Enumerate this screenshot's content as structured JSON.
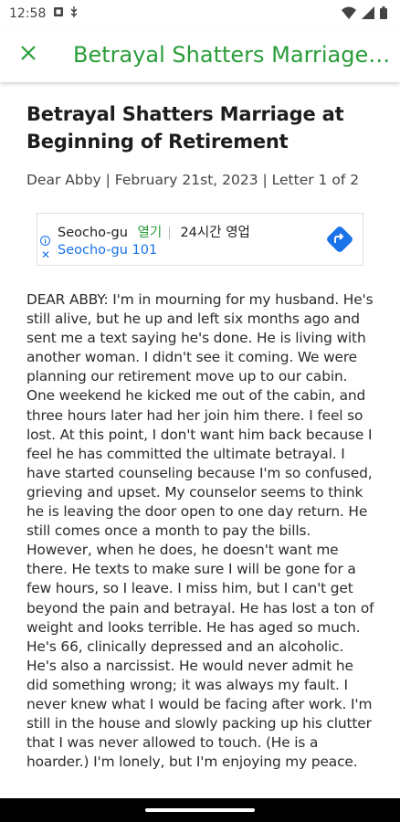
{
  "status_bar": {
    "time": "12:58"
  },
  "app_bar": {
    "title": "Betrayal Shatters Marriage…"
  },
  "article": {
    "headline": "Betrayal Shatters Marriage at Beginning of Retirement",
    "byline": "Dear Abby | February 21st, 2023 | Letter 1 of 2",
    "body": "DEAR ABBY: I'm in mourning for my husband. He's still alive, but he up and left six months ago and sent me a text saying he's done. He is living with another woman. I didn't see it coming. We were planning our retirement move up to our cabin. One weekend he kicked me out of the cabin, and three hours later had her join him there. I feel so lost. At this point, I don't want him back because I feel he has committed the ultimate betrayal. I have started counseling because I'm so confused, grieving and upset. My counselor seems to think he is leaving the door open to one day return. He still comes once a month to pay the bills. However, when he does, he doesn't want me there. He texts to make sure I will be gone for a few hours, so I leave. I miss him, but I can't get beyond the pain and betrayal. He has lost a ton of weight and looks terrible. He has aged so much. He's 66, clinically depressed and an alcoholic. He's also a narcissist. He would never admit he did something wrong; it was always my fault. I never knew what I would be facing after work. I'm still in the house and slowly packing up his clutter that I was never allowed to touch. (He is a hoarder.) I'm lonely, but I'm enjoying my peace."
  },
  "ad": {
    "business": "Seocho-gu",
    "status": "열기",
    "hours": "24시간 영업",
    "address": "Seocho-gu 101"
  },
  "icons": {
    "close": "close-icon",
    "directions": "directions-icon",
    "ad_info": "info-icon",
    "ad_close": "ad-close-icon"
  },
  "colors": {
    "accent": "#2a9d3a",
    "link": "#1a73e8"
  }
}
